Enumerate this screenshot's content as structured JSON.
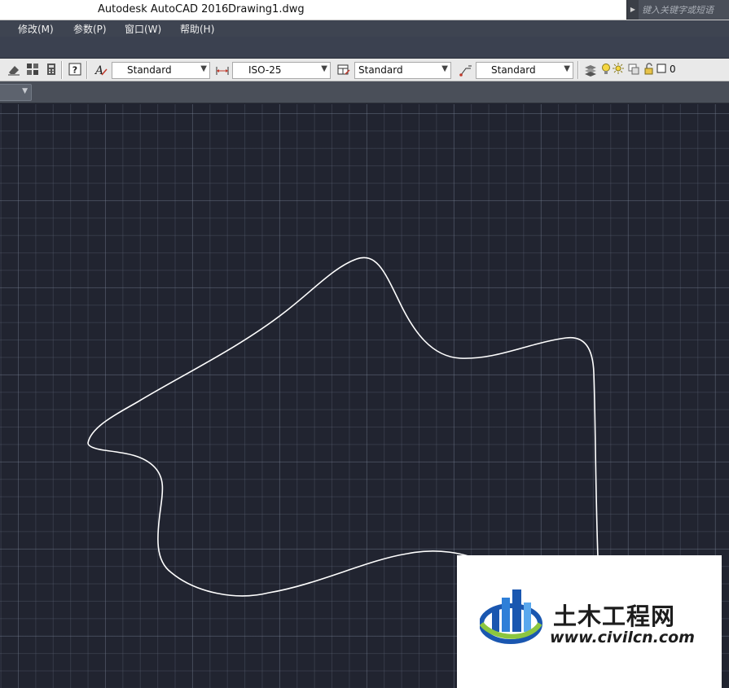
{
  "window": {
    "app_title": "Autodesk AutoCAD 2016",
    "file_name": "Drawing1.dwg",
    "search_placeholder": "键入关键字或短语"
  },
  "menu": {
    "items": [
      {
        "label": "修改(M)"
      },
      {
        "label": "参数(P)"
      },
      {
        "label": "窗口(W)"
      },
      {
        "label": "帮助(H)"
      }
    ]
  },
  "styles_toolbar": {
    "text_style": "Standard",
    "dimension_style": "ISO-25",
    "table_style": "Standard",
    "multileader_style": "Standard",
    "current_layer": "0"
  },
  "canvas": {
    "background_color": "#212430",
    "curve_color": "#ffffff"
  },
  "watermark": {
    "title": "土木工程网",
    "url": "www.civilcn.com"
  }
}
